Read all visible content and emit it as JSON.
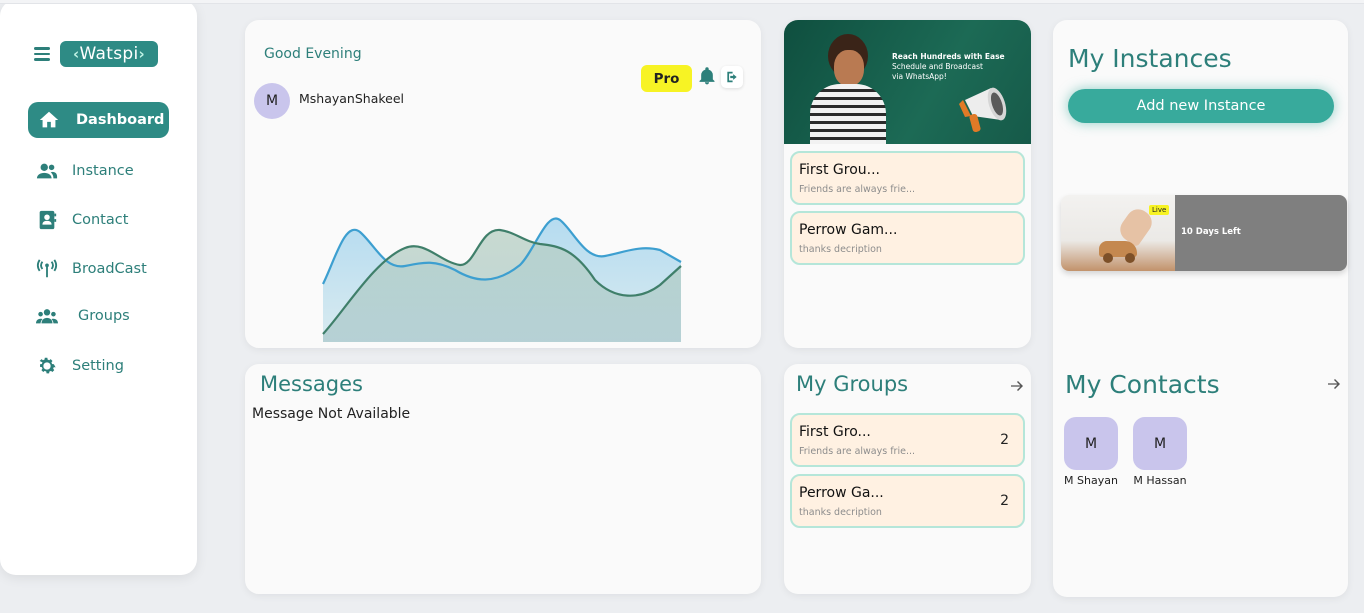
{
  "logo": {
    "name": "Watspi"
  },
  "sidebar": {
    "items": [
      {
        "label": "Dashboard",
        "icon": "home-icon",
        "active": true
      },
      {
        "label": "Instance",
        "icon": "users-icon"
      },
      {
        "label": "Contact",
        "icon": "contact-book-icon"
      },
      {
        "label": "BroadCast",
        "icon": "broadcast-antenna-icon"
      },
      {
        "label": "Groups",
        "icon": "groups-icon"
      },
      {
        "label": "Setting",
        "icon": "gear-icon"
      }
    ]
  },
  "header": {
    "greeting": "Good Evening",
    "plan_badge": "Pro",
    "user_initial": "M",
    "username": "MshayanShakeel"
  },
  "messages": {
    "title": "Messages",
    "empty_text": "Message Not Available"
  },
  "promo": {
    "headline": "Reach Hundreds with Ease",
    "line2": "Schedule and Broadcast",
    "line3": "via WhatsApp!",
    "groups": [
      {
        "name": "First Grou...",
        "desc": "Friends are always frie..."
      },
      {
        "name": "Perrow Gam...",
        "desc": "thanks decription"
      }
    ]
  },
  "my_groups": {
    "title": "My Groups",
    "items": [
      {
        "name": "First Gro...",
        "desc": "Friends are always frie...",
        "count": "2"
      },
      {
        "name": "Perrow Ga...",
        "desc": "thanks decription",
        "count": "2"
      }
    ]
  },
  "instances": {
    "title": "My Instances",
    "add_button": "Add new Instance",
    "card": {
      "status": "Live",
      "days_left": "10 Days Left"
    }
  },
  "contacts": {
    "title": "My Contacts",
    "items": [
      {
        "initial": "M",
        "name": "M Shayan"
      },
      {
        "initial": "M",
        "name": "M Hassan"
      }
    ]
  },
  "colors": {
    "brand": "#2e8b85",
    "pro_badge": "#f7f324",
    "group_card_bg": "#fff1e2",
    "avatar_bg": "#c9c5ec"
  }
}
